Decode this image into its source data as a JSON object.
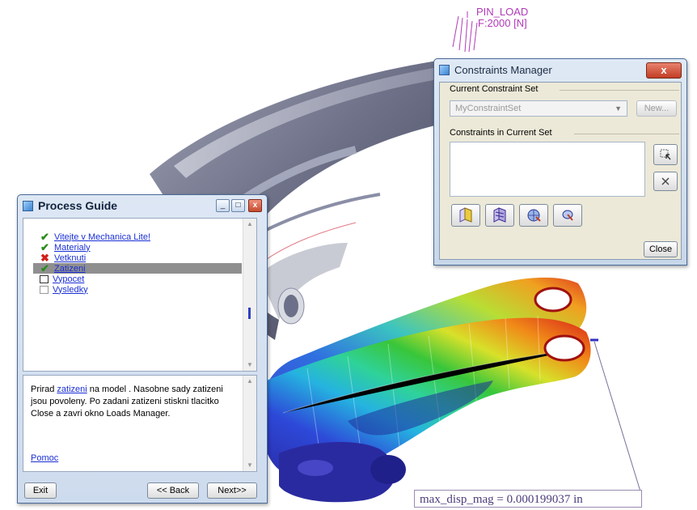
{
  "annotations": {
    "pin_load_line1": "PIN_LOAD",
    "pin_load_line2": "F:2000 [N]",
    "max_disp": "max_disp_mag = 0.000199037  in"
  },
  "constraints_manager": {
    "title": "Constraints Manager",
    "close_x": "x",
    "current_set_label": "Current Constraint Set",
    "current_set_value": "MyConstraintSet",
    "new_button": "New...",
    "constraints_label": "Constraints in Current Set",
    "close_button": "Close",
    "icons": [
      "constraint-edit-icon",
      "delete-x-icon",
      "face-constraint-icon",
      "edge-constraint-icon",
      "sphere-constraint-icon",
      "pin-constraint-icon"
    ]
  },
  "process_guide": {
    "title": "Process Guide",
    "steps": [
      {
        "label": "Vitejte v Mechanica Lite!",
        "status": "done"
      },
      {
        "label": "Materialy",
        "status": "done"
      },
      {
        "label": "Vetknuti",
        "status": "error"
      },
      {
        "label": "Zatizeni",
        "status": "done",
        "selected": true
      },
      {
        "label": "Vypocet",
        "status": "pending"
      },
      {
        "label": "Vysledky",
        "status": "disabled"
      }
    ],
    "help": {
      "before_link": "Prirad ",
      "link": "zatizeni",
      "after_link": " na model . Nasobne sady zatizeni jsou povoleny. Po zadani zatizeni stiskni tlacitko Close a zavri okno Loads Manager.",
      "pomoc": "Pomoc"
    },
    "buttons": {
      "exit": "Exit",
      "back": "<< Back",
      "next": "Next>>"
    }
  },
  "colors": {
    "link": "#1a2fd6",
    "check": "#2b8a1e",
    "cross": "#d0221a",
    "selected_row": "#8f8f8f",
    "pin_load": "#b03ab8"
  }
}
